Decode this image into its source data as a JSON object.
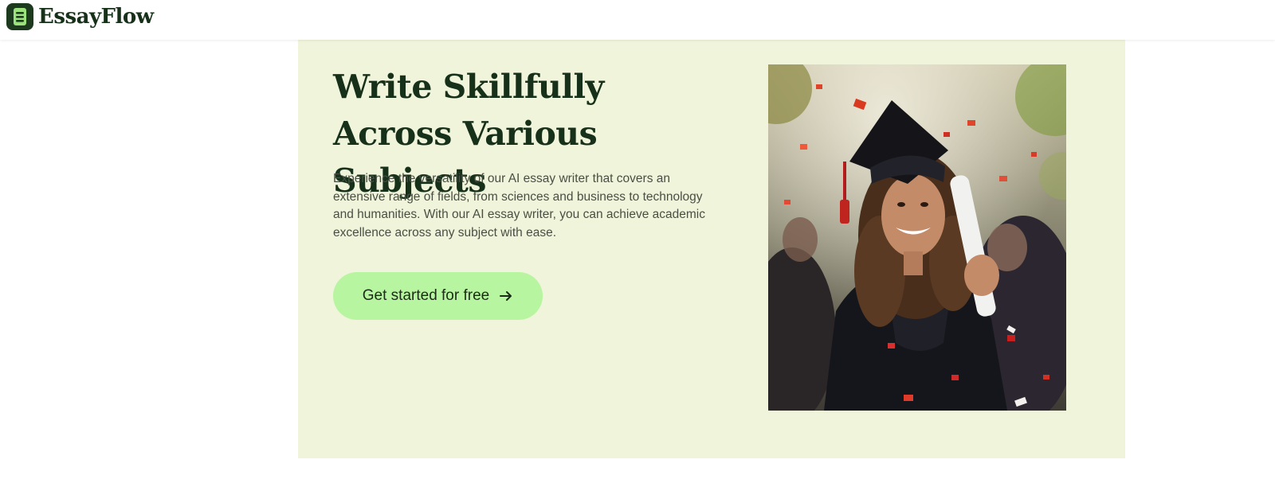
{
  "header": {
    "logo_text": "EssayFlow",
    "logo_icon": "notebook-icon"
  },
  "hero": {
    "title": "Write Skillfully Across Various Subjects",
    "description": "Experience the versatility of our AI essay writer that covers an extensive range of fields, from sciences and business to technology and humanities. With our AI essay writer, you can achieve academic excellence across any subject with ease.",
    "cta_label": "Get started for free",
    "cta_icon": "arrow-right-icon",
    "image": "graduate-photo"
  },
  "colors": {
    "brand_dark": "#17301a",
    "hero_background": "#eff4da",
    "cta_background": "#b8f5a0",
    "body_text": "#4a4f45"
  }
}
